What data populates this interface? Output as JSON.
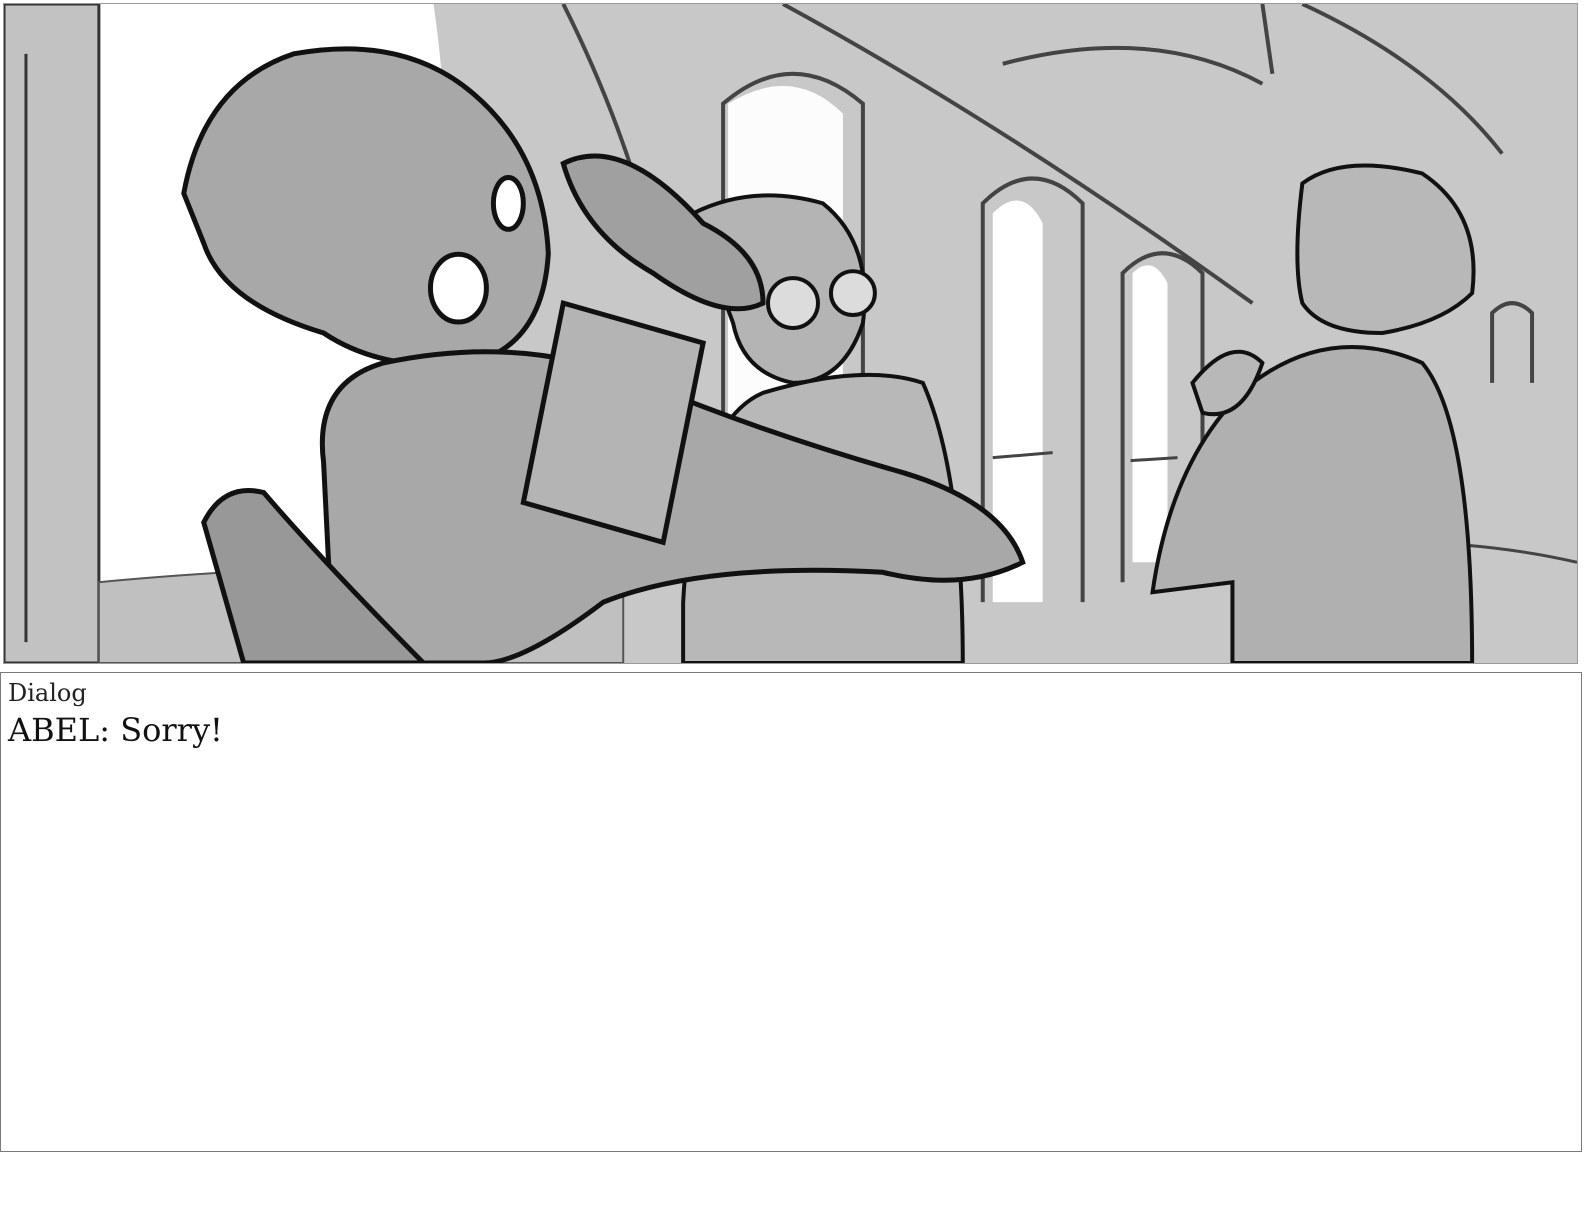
{
  "panel": {
    "scene": "storyboard-frame",
    "palette": {
      "background": "#c8c8c8",
      "sky": "#ffffff",
      "figure": "#a8a8a8",
      "line": "#111111"
    }
  },
  "dialog": {
    "label": "Dialog",
    "text": "ABEL: Sorry!"
  }
}
